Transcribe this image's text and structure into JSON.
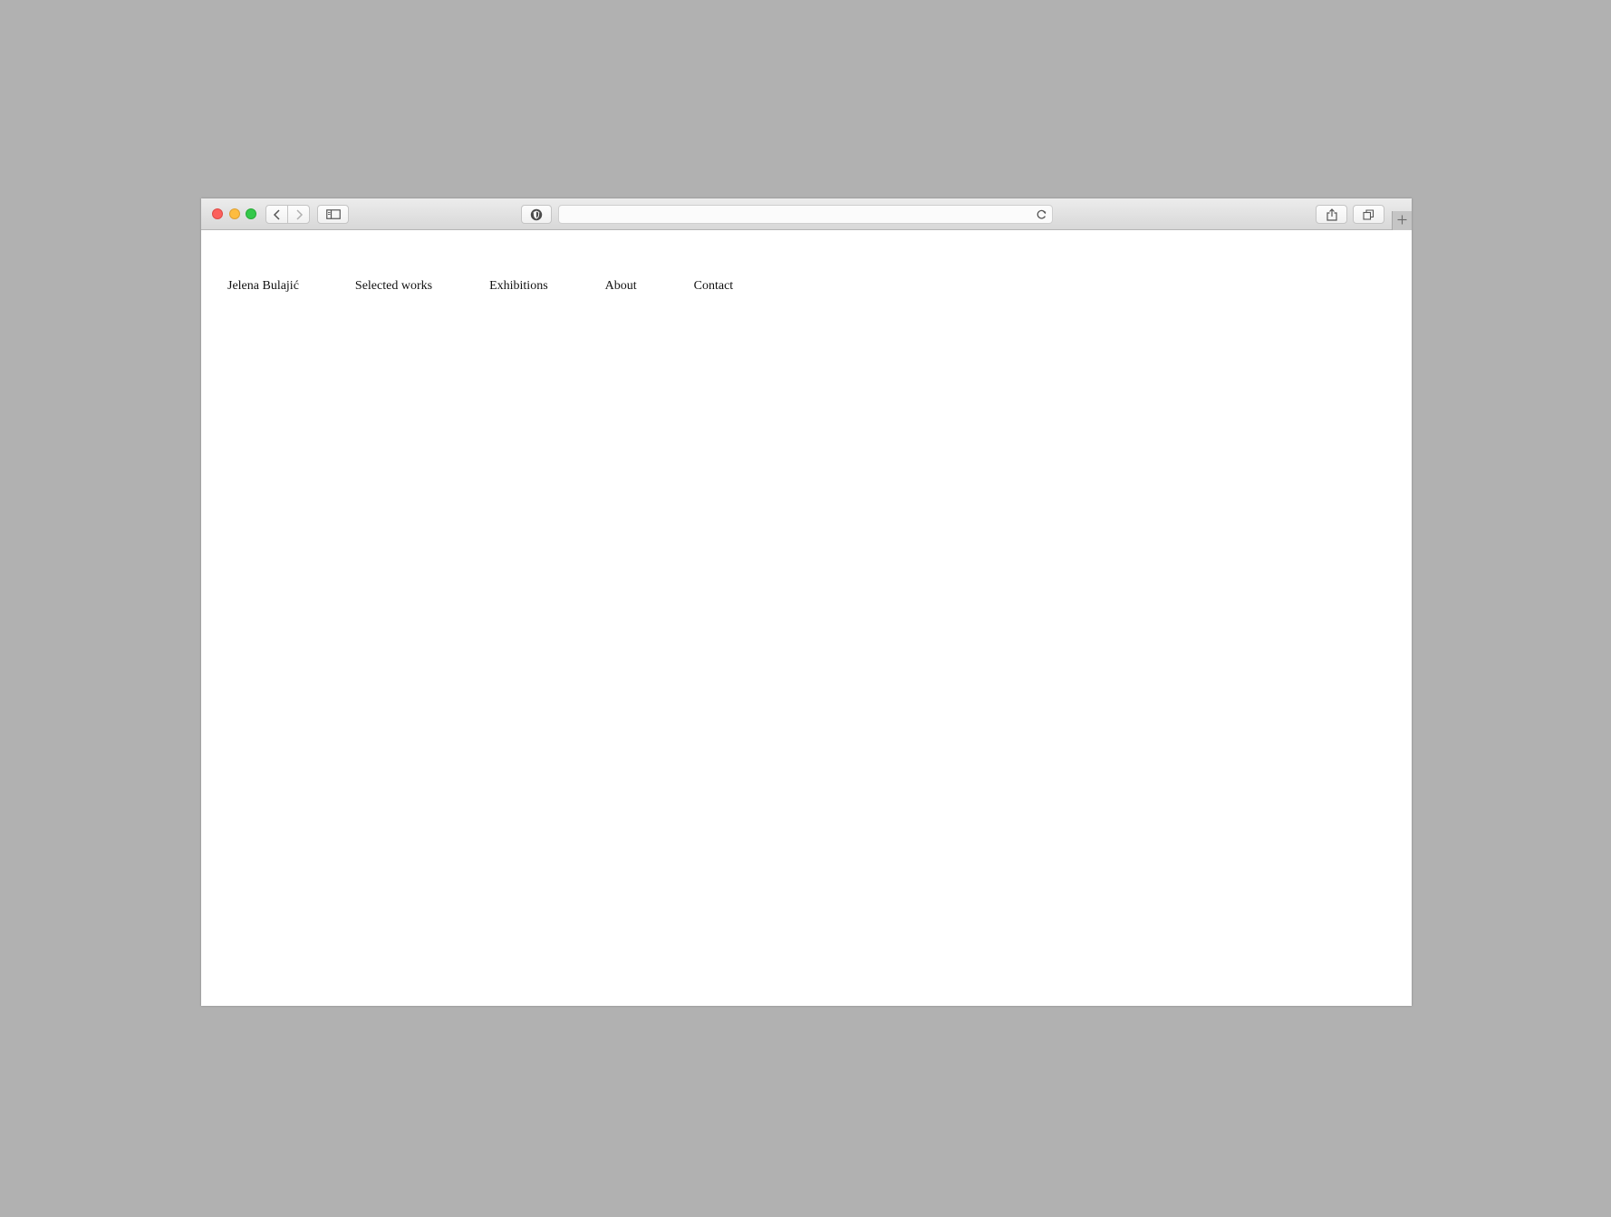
{
  "browser": {
    "address_value": "",
    "address_placeholder": ""
  },
  "site": {
    "nav": [
      {
        "label": "Jelena Bulajić"
      },
      {
        "label": "Selected works"
      },
      {
        "label": "Exhibitions"
      },
      {
        "label": "About"
      },
      {
        "label": "Contact"
      }
    ]
  },
  "colors": {
    "background": "#b1b1b1",
    "page": "#ffffff",
    "close": "#fc605c",
    "minimize": "#fdbc40",
    "zoom": "#34c84a",
    "text": "#111111"
  },
  "icons": {
    "back": "chevron-left-icon",
    "forward": "chevron-right-icon",
    "sidebar": "sidebar-icon",
    "privacy": "privacy-report-icon",
    "reload": "reload-icon",
    "share": "share-icon",
    "tabs": "tab-overview-icon",
    "new_tab": "plus-icon"
  }
}
